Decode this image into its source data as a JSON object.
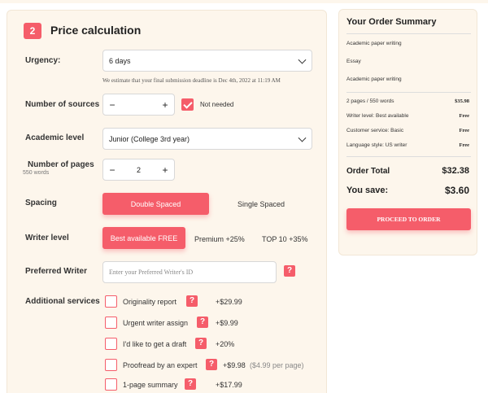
{
  "calc": {
    "step_num": "2",
    "title": "Price calculation",
    "urgency": {
      "label": "Urgency:",
      "value": "6 days",
      "note": "We estimate that your final submission deadline is Dec 4th, 2022 at 11:19 AM"
    },
    "sources": {
      "label": "Number of sources",
      "minus": "−",
      "plus": "+",
      "value": "",
      "not_needed": "Not needed",
      "not_needed_checked": true
    },
    "academic": {
      "label": "Academic level",
      "value": "Junior (College 3rd year)"
    },
    "pages": {
      "label": "Number of pages",
      "sub": "550 words",
      "minus": "−",
      "value": "2",
      "plus": "+"
    },
    "spacing": {
      "label": "Spacing",
      "double": "Double Spaced",
      "single": "Single Spaced",
      "selected": "double"
    },
    "writer": {
      "label": "Writer level",
      "best": "Best available FREE",
      "premium": "Premium +25%",
      "top": "TOP 10 +35%",
      "selected": "best"
    },
    "preferred": {
      "label": "Preferred Writer",
      "placeholder": "Enter your Preferred Writer's ID",
      "help": "?"
    },
    "additional": {
      "label": "Additional services",
      "items": [
        {
          "name": "Originality report",
          "price": "+$29.99",
          "extra": ""
        },
        {
          "name": "Urgent writer assign",
          "price": "+$9.99",
          "extra": ""
        },
        {
          "name": "I'd like to get a draft",
          "price": "+20%",
          "extra": ""
        },
        {
          "name": "Proofread by an expert",
          "price": "+$9.98",
          "extra": "($4.99 per page)"
        },
        {
          "name": "1-page summary",
          "price": "+$17.99",
          "extra": ""
        }
      ],
      "help": "?"
    }
  },
  "summary": {
    "title": "Your Order Summary",
    "lines": [
      "Academic paper writing",
      "Essay",
      "Academic paper writing"
    ],
    "rows": [
      {
        "label": "2 pages / 550 words",
        "value": "$35.98"
      },
      {
        "label": "Writer level: Best available",
        "value": "Free"
      },
      {
        "label": "Customer service: Basic",
        "value": "Free"
      },
      {
        "label": "Language style: US writer",
        "value": "Free"
      }
    ],
    "total_label": "Order Total",
    "total_value": "$32.38",
    "save_label": "You save:",
    "save_value": "$3.60",
    "proceed": "PROCEED TO ORDER"
  },
  "colors": {
    "accent": "#f55d6a",
    "panel": "#fdf6ec"
  }
}
